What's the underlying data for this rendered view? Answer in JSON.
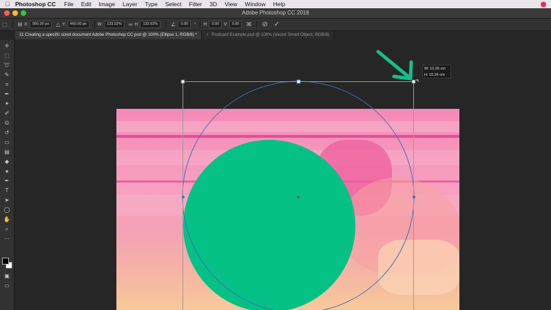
{
  "menubar": {
    "app_name": "Photoshop CC",
    "items": [
      "File",
      "Edit",
      "Image",
      "Layer",
      "Type",
      "Select",
      "Filter",
      "3D",
      "View",
      "Window",
      "Help"
    ]
  },
  "window": {
    "title": "Adobe Photoshop CC 2018"
  },
  "options_bar": {
    "x_label": "X:",
    "x_value": "956.00 px",
    "y_label": "Y:",
    "y_value": "460.00 px",
    "w_label": "W:",
    "w_value": "133.92%",
    "h_label": "H:",
    "h_value": "133.92%",
    "angle_value": "0.00",
    "hskew_label": "H:",
    "hskew_value": "0.00",
    "vskew_label": "V:",
    "vskew_value": "0.00"
  },
  "tabs": [
    {
      "label": "11 Creating a specific sized document Adobe Photoshop CC.psd @ 100% (Ellipse 1, RGB/8) *"
    },
    {
      "label": "Postcard Example.psd @ 100% (Vector Smart Object, RGB/8)"
    }
  ],
  "transform_tooltip": {
    "w": "W: 10.26 cm",
    "h": "H: 10.26 cm"
  },
  "colors": {
    "ellipse_fill": "#05c185",
    "arrow": "#13c08a",
    "path_outline": "#3d6fb3",
    "accent_pink": "#f48ab6"
  },
  "icons": [
    "apple-icon",
    "move-tool-icon",
    "cancel-transform-icon",
    "commit-transform-icon",
    "warp-icon"
  ]
}
